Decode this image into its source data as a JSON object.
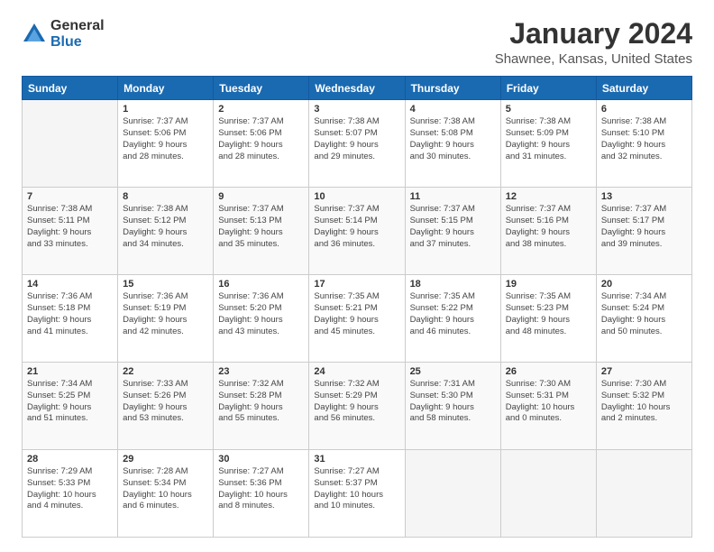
{
  "logo": {
    "general": "General",
    "blue": "Blue"
  },
  "title": "January 2024",
  "subtitle": "Shawnee, Kansas, United States",
  "days_of_week": [
    "Sunday",
    "Monday",
    "Tuesday",
    "Wednesday",
    "Thursday",
    "Friday",
    "Saturday"
  ],
  "weeks": [
    [
      {
        "day": "",
        "sunrise": "",
        "sunset": "",
        "daylight": ""
      },
      {
        "day": "1",
        "sunrise": "Sunrise: 7:37 AM",
        "sunset": "Sunset: 5:06 PM",
        "daylight": "Daylight: 9 hours and 28 minutes."
      },
      {
        "day": "2",
        "sunrise": "Sunrise: 7:37 AM",
        "sunset": "Sunset: 5:06 PM",
        "daylight": "Daylight: 9 hours and 28 minutes."
      },
      {
        "day": "3",
        "sunrise": "Sunrise: 7:38 AM",
        "sunset": "Sunset: 5:07 PM",
        "daylight": "Daylight: 9 hours and 29 minutes."
      },
      {
        "day": "4",
        "sunrise": "Sunrise: 7:38 AM",
        "sunset": "Sunset: 5:08 PM",
        "daylight": "Daylight: 9 hours and 30 minutes."
      },
      {
        "day": "5",
        "sunrise": "Sunrise: 7:38 AM",
        "sunset": "Sunset: 5:09 PM",
        "daylight": "Daylight: 9 hours and 31 minutes."
      },
      {
        "day": "6",
        "sunrise": "Sunrise: 7:38 AM",
        "sunset": "Sunset: 5:10 PM",
        "daylight": "Daylight: 9 hours and 32 minutes."
      }
    ],
    [
      {
        "day": "7",
        "sunrise": "Sunrise: 7:38 AM",
        "sunset": "Sunset: 5:11 PM",
        "daylight": "Daylight: 9 hours and 33 minutes."
      },
      {
        "day": "8",
        "sunrise": "Sunrise: 7:38 AM",
        "sunset": "Sunset: 5:12 PM",
        "daylight": "Daylight: 9 hours and 34 minutes."
      },
      {
        "day": "9",
        "sunrise": "Sunrise: 7:37 AM",
        "sunset": "Sunset: 5:13 PM",
        "daylight": "Daylight: 9 hours and 35 minutes."
      },
      {
        "day": "10",
        "sunrise": "Sunrise: 7:37 AM",
        "sunset": "Sunset: 5:14 PM",
        "daylight": "Daylight: 9 hours and 36 minutes."
      },
      {
        "day": "11",
        "sunrise": "Sunrise: 7:37 AM",
        "sunset": "Sunset: 5:15 PM",
        "daylight": "Daylight: 9 hours and 37 minutes."
      },
      {
        "day": "12",
        "sunrise": "Sunrise: 7:37 AM",
        "sunset": "Sunset: 5:16 PM",
        "daylight": "Daylight: 9 hours and 38 minutes."
      },
      {
        "day": "13",
        "sunrise": "Sunrise: 7:37 AM",
        "sunset": "Sunset: 5:17 PM",
        "daylight": "Daylight: 9 hours and 39 minutes."
      }
    ],
    [
      {
        "day": "14",
        "sunrise": "Sunrise: 7:36 AM",
        "sunset": "Sunset: 5:18 PM",
        "daylight": "Daylight: 9 hours and 41 minutes."
      },
      {
        "day": "15",
        "sunrise": "Sunrise: 7:36 AM",
        "sunset": "Sunset: 5:19 PM",
        "daylight": "Daylight: 9 hours and 42 minutes."
      },
      {
        "day": "16",
        "sunrise": "Sunrise: 7:36 AM",
        "sunset": "Sunset: 5:20 PM",
        "daylight": "Daylight: 9 hours and 43 minutes."
      },
      {
        "day": "17",
        "sunrise": "Sunrise: 7:35 AM",
        "sunset": "Sunset: 5:21 PM",
        "daylight": "Daylight: 9 hours and 45 minutes."
      },
      {
        "day": "18",
        "sunrise": "Sunrise: 7:35 AM",
        "sunset": "Sunset: 5:22 PM",
        "daylight": "Daylight: 9 hours and 46 minutes."
      },
      {
        "day": "19",
        "sunrise": "Sunrise: 7:35 AM",
        "sunset": "Sunset: 5:23 PM",
        "daylight": "Daylight: 9 hours and 48 minutes."
      },
      {
        "day": "20",
        "sunrise": "Sunrise: 7:34 AM",
        "sunset": "Sunset: 5:24 PM",
        "daylight": "Daylight: 9 hours and 50 minutes."
      }
    ],
    [
      {
        "day": "21",
        "sunrise": "Sunrise: 7:34 AM",
        "sunset": "Sunset: 5:25 PM",
        "daylight": "Daylight: 9 hours and 51 minutes."
      },
      {
        "day": "22",
        "sunrise": "Sunrise: 7:33 AM",
        "sunset": "Sunset: 5:26 PM",
        "daylight": "Daylight: 9 hours and 53 minutes."
      },
      {
        "day": "23",
        "sunrise": "Sunrise: 7:32 AM",
        "sunset": "Sunset: 5:28 PM",
        "daylight": "Daylight: 9 hours and 55 minutes."
      },
      {
        "day": "24",
        "sunrise": "Sunrise: 7:32 AM",
        "sunset": "Sunset: 5:29 PM",
        "daylight": "Daylight: 9 hours and 56 minutes."
      },
      {
        "day": "25",
        "sunrise": "Sunrise: 7:31 AM",
        "sunset": "Sunset: 5:30 PM",
        "daylight": "Daylight: 9 hours and 58 minutes."
      },
      {
        "day": "26",
        "sunrise": "Sunrise: 7:30 AM",
        "sunset": "Sunset: 5:31 PM",
        "daylight": "Daylight: 10 hours and 0 minutes."
      },
      {
        "day": "27",
        "sunrise": "Sunrise: 7:30 AM",
        "sunset": "Sunset: 5:32 PM",
        "daylight": "Daylight: 10 hours and 2 minutes."
      }
    ],
    [
      {
        "day": "28",
        "sunrise": "Sunrise: 7:29 AM",
        "sunset": "Sunset: 5:33 PM",
        "daylight": "Daylight: 10 hours and 4 minutes."
      },
      {
        "day": "29",
        "sunrise": "Sunrise: 7:28 AM",
        "sunset": "Sunset: 5:34 PM",
        "daylight": "Daylight: 10 hours and 6 minutes."
      },
      {
        "day": "30",
        "sunrise": "Sunrise: 7:27 AM",
        "sunset": "Sunset: 5:36 PM",
        "daylight": "Daylight: 10 hours and 8 minutes."
      },
      {
        "day": "31",
        "sunrise": "Sunrise: 7:27 AM",
        "sunset": "Sunset: 5:37 PM",
        "daylight": "Daylight: 10 hours and 10 minutes."
      },
      {
        "day": "",
        "sunrise": "",
        "sunset": "",
        "daylight": ""
      },
      {
        "day": "",
        "sunrise": "",
        "sunset": "",
        "daylight": ""
      },
      {
        "day": "",
        "sunrise": "",
        "sunset": "",
        "daylight": ""
      }
    ]
  ]
}
